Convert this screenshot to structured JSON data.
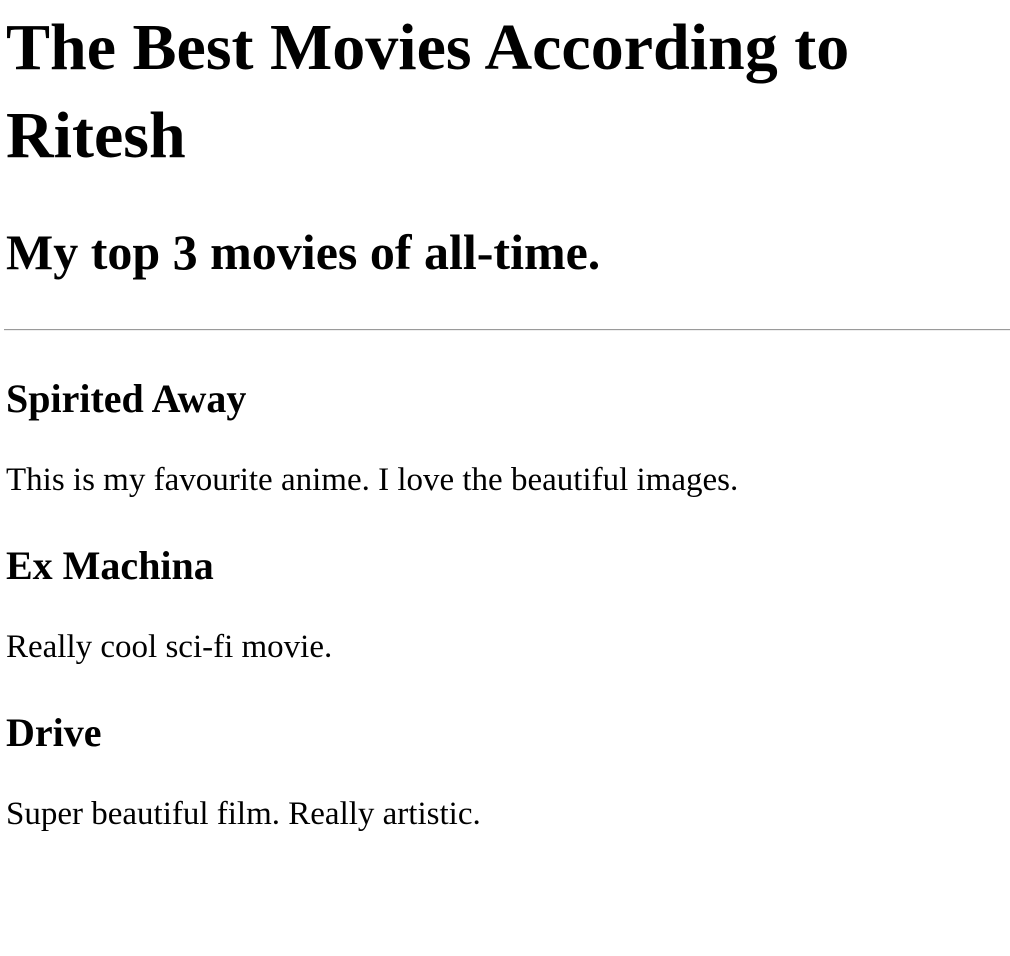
{
  "header": {
    "title": "The Best Movies According to Ritesh",
    "subtitle": "My top 3 movies of all-time."
  },
  "movies": [
    {
      "title": "Spirited Away",
      "description": "This is my favourite anime. I love the beautiful images."
    },
    {
      "title": "Ex Machina",
      "description": "Really cool sci-fi movie."
    },
    {
      "title": "Drive",
      "description": "Super beautiful film. Really artistic."
    }
  ]
}
